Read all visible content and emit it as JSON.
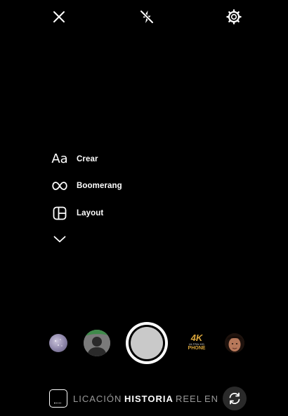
{
  "top_bar": {
    "close_icon": "close-icon",
    "flash_icon": "flash-off-icon",
    "settings_icon": "settings-icon"
  },
  "tools": [
    {
      "icon": "text-aa-icon",
      "icon_text": "Aa",
      "label": "Crear"
    },
    {
      "icon": "infinity-icon",
      "label": "Boomerang"
    },
    {
      "icon": "layout-icon",
      "label": "Layout"
    },
    {
      "icon": "chevron-down-icon",
      "label": ""
    }
  ],
  "effects": {
    "badge_4k": {
      "big": "4K",
      "line1": "ULTRA HD",
      "line2": "PHONE"
    }
  },
  "modes": {
    "items": [
      "LICACIÓN",
      "HISTORIA",
      "REEL",
      "EN"
    ],
    "active": "HISTORIA"
  },
  "colors": {
    "background": "#000000",
    "shutter_core": "#c9c9c9",
    "inactive_mode": "#9a9a9a",
    "badge_gold": "#d9a53b"
  }
}
